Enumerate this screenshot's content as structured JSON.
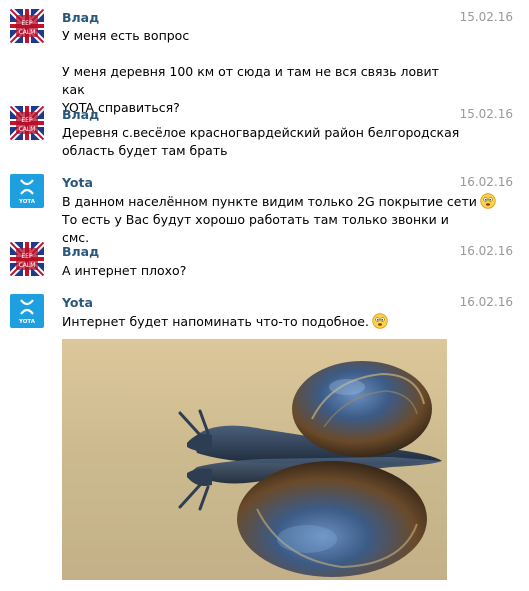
{
  "messages": [
    {
      "sender": "Влад",
      "avatar": "keep-calm-uk-flag-avatar",
      "date": "15.02.16",
      "lines": [
        "У меня есть вопрос",
        "",
        "У меня деревня 100 км от сюда и там не вся связь ловит как",
        "YOTA справиться?"
      ]
    },
    {
      "sender": "Влад",
      "avatar": "keep-calm-uk-flag-avatar",
      "date": "15.02.16",
      "lines": [
        "Деревня с.весёлое красногвардейский район белгородская",
        "область будет там брать"
      ]
    },
    {
      "sender": "Yota",
      "avatar": "yota-logo-avatar",
      "date": "16.02.16",
      "lines": [
        "В данном населённом пункте видим только 2G покрытие сети",
        "То есть у Вас будут хорошо работать там только звонки и смс."
      ]
    },
    {
      "sender": "Влад",
      "avatar": "keep-calm-uk-flag-avatar",
      "date": "16.02.16",
      "lines": [
        "А интернет плохо?"
      ]
    },
    {
      "sender": "Yota",
      "avatar": "yota-logo-avatar",
      "date": "16.02.16",
      "lines": [
        "Интернет будет напоминать что-то подобное."
      ],
      "attachment": "snail-photo"
    }
  ],
  "avatar_text": {
    "keep_calm_top": "EEP",
    "keep_calm_bottom": "CALM",
    "yota": "YOTA"
  }
}
